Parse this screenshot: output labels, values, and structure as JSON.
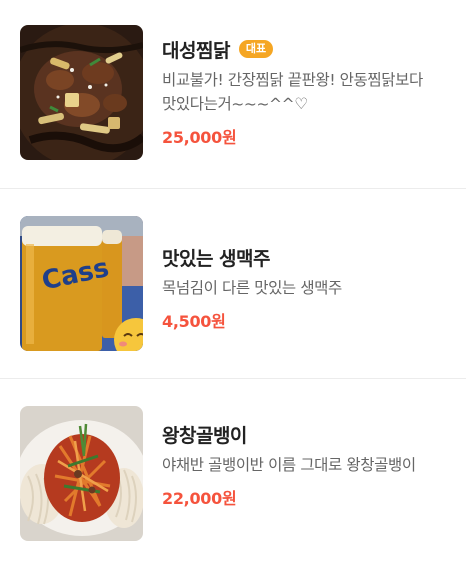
{
  "colors": {
    "badge_bg": "#f5a623",
    "price": "#f5533d",
    "name": "#222222",
    "desc": "#666666",
    "divider": "#ececec"
  },
  "menu": {
    "items": [
      {
        "name": "대성찜닭",
        "badge": "대표",
        "description": "비교불가! 간장찜닭 끝판왕! 안동찜닭보다 맛있다는거~~~^^♡",
        "price": "25,000원",
        "image": "braised-chicken-photo"
      },
      {
        "name": "맛있는 생맥주",
        "description": "목넘김이 다른 맛있는 생맥주",
        "price": "4,500원",
        "image": "draft-beer-photo"
      },
      {
        "name": "왕창골뱅이",
        "description": "야채반 골뱅이반 이름 그대로 왕창골뱅이",
        "price": "22,000원",
        "image": "sea-snail-salad-photo"
      }
    ]
  }
}
